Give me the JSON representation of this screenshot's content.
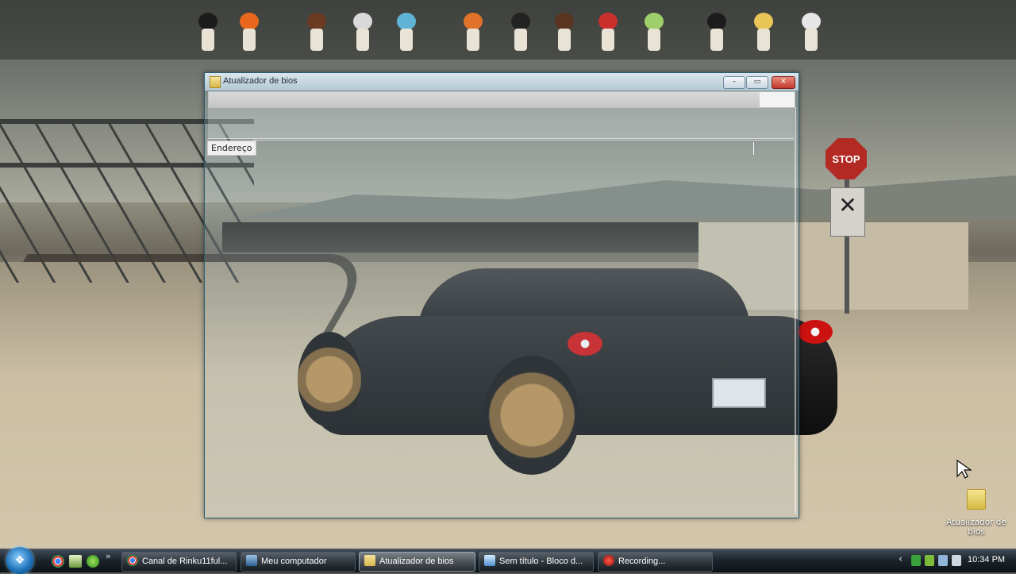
{
  "window": {
    "title": "Atualizador de bios",
    "minimize_glyph": "–",
    "maximize_glyph": "▭",
    "close_glyph": "✕",
    "progress_fraction": 0.94,
    "address_label": "Endereço"
  },
  "wallpaper": {
    "stop_sign_text": "STOP",
    "crossing_sign_glyph": "✕"
  },
  "desktop": {
    "icons": [
      {
        "label": "Atualizador de bios",
        "icon": "folder-icon"
      }
    ]
  },
  "dock": {
    "figure_colors": [
      "#1b1b1b",
      "#e8671c",
      "#6b3a22",
      "#d9d9d9",
      "#5fb4d6",
      "#e0722a",
      "#222222",
      "#5a3420",
      "#c9302c",
      "#9fcf6a",
      "#1c1c1c",
      "#e8c556",
      "#e6e6e6"
    ]
  },
  "taskbar": {
    "start_glyph": "❖",
    "quick_launch": [
      "chrome-icon",
      "folder-network-icon",
      "utorrent-icon"
    ],
    "quick_launch_more": "»",
    "tasks": [
      {
        "label": "Canal de Rinku11ful...",
        "icon": "chrome-icon",
        "active": false
      },
      {
        "label": "Meu computador",
        "icon": "computer-icon",
        "active": false
      },
      {
        "label": "Atualizador de bios",
        "icon": "folder-icon",
        "active": true
      },
      {
        "label": "Sem título - Bloco d...",
        "icon": "notepad-icon",
        "active": false
      },
      {
        "label": "Recording...",
        "icon": "recorder-icon",
        "active": false
      }
    ],
    "tray_expand": "‹",
    "clock": "10:34 PM"
  }
}
